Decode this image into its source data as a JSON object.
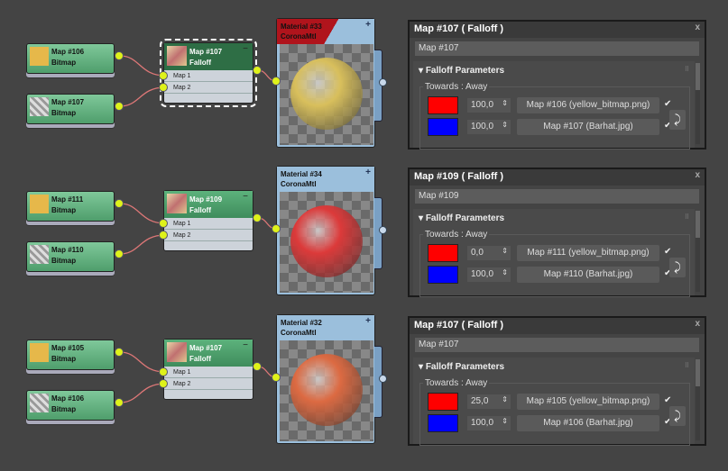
{
  "rows": [
    {
      "bitmap1": {
        "label": "Map #106",
        "type": "Bitmap",
        "thumb": "#e6b84a"
      },
      "bitmap2": {
        "label": "Map #107",
        "type": "Bitmap",
        "thumb": "#bbb"
      },
      "falloff": {
        "label": "Map #107",
        "type": "Falloff",
        "slot1": "Map 1",
        "slot2": "Map 2",
        "min": "−",
        "selected": true
      },
      "material": {
        "label": "Material #33",
        "type": "CoronaMtl",
        "plus": "+",
        "header_color": "#b0141c",
        "sphere": "#d8bf5c"
      },
      "panel": {
        "title": "Map #107  ( Falloff )",
        "close": "x",
        "name": "Map #107",
        "rollout": "Falloff Parameters",
        "group": "Towards : Away",
        "line1": {
          "color": "#ff0000",
          "value": "100,0",
          "map": "Map #106 (yellow_bitmap.png)",
          "checked": "✔"
        },
        "line2": {
          "color": "#0000ff",
          "value": "100,0",
          "map": "Map #107 (Barhat.jpg)",
          "checked": "✔"
        }
      }
    },
    {
      "bitmap1": {
        "label": "Map #111",
        "type": "Bitmap",
        "thumb": "#e6b84a"
      },
      "bitmap2": {
        "label": "Map #110",
        "type": "Bitmap",
        "thumb": "#bbb"
      },
      "falloff": {
        "label": "Map #109",
        "type": "Falloff",
        "slot1": "Map 1",
        "slot2": "Map 2",
        "min": "−",
        "selected": false
      },
      "material": {
        "label": "Material #34",
        "type": "CoronaMtl",
        "plus": "+",
        "header_color": "#9bbfdc",
        "sphere": "#dc3a3a"
      },
      "panel": {
        "title": "Map #109  ( Falloff )",
        "close": "x",
        "name": "Map #109",
        "rollout": "Falloff Parameters",
        "group": "Towards : Away",
        "line1": {
          "color": "#ff0000",
          "value": "0,0",
          "map": "Map #111 (yellow_bitmap.png)",
          "checked": "✔"
        },
        "line2": {
          "color": "#0000ff",
          "value": "100,0",
          "map": "Map #110 (Barhat.jpg)",
          "checked": "✔"
        }
      }
    },
    {
      "bitmap1": {
        "label": "Map #105",
        "type": "Bitmap",
        "thumb": "#e6b84a"
      },
      "bitmap2": {
        "label": "Map #106",
        "type": "Bitmap",
        "thumb": "#bbb"
      },
      "falloff": {
        "label": "Map #107",
        "type": "Falloff",
        "slot1": "Map 1",
        "slot2": "Map 2",
        "min": "−",
        "selected": false
      },
      "material": {
        "label": "Material #32",
        "type": "CoronaMtl",
        "plus": "+",
        "header_color": "#9bbfdc",
        "sphere": "#dc6a42"
      },
      "panel": {
        "title": "Map #107  ( Falloff )",
        "close": "x",
        "name": "Map #107",
        "rollout": "Falloff Parameters",
        "group": "Towards : Away",
        "line1": {
          "color": "#ff0000",
          "value": "25,0",
          "map": "Map #105 (yellow_bitmap.png)",
          "checked": "✔"
        },
        "line2": {
          "color": "#0000ff",
          "value": "100,0",
          "map": "Map #106 (Barhat.jpg)",
          "checked": "✔"
        }
      }
    }
  ]
}
